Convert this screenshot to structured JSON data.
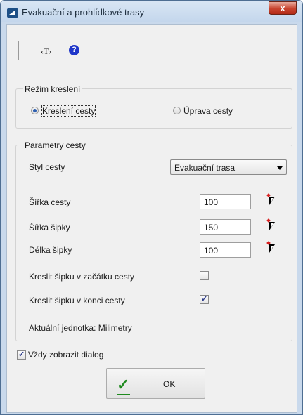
{
  "window": {
    "title": "Evakuační a prohlídkové trasy",
    "close_glyph": "x",
    "icons": [
      "app-icon",
      "close-icon"
    ]
  },
  "toolbar": {
    "text_tool_label": "‹T›",
    "help_glyph": "?",
    "icons": [
      "separator-handle-icon",
      "text-tool-icon",
      "help-icon"
    ]
  },
  "mode_group": {
    "title": "Režim kreslení",
    "options": [
      {
        "label": "Kreslení cesty",
        "selected": true
      },
      {
        "label": "Úprava cesty",
        "selected": false
      }
    ]
  },
  "params_group": {
    "title": "Parametry cesty",
    "style_label": "Styl cesty",
    "style_value": "Evakuační trasa",
    "path_width_label": "Šířka cesty",
    "path_width_value": "100",
    "arrow_width_label": "Šířka šipky",
    "arrow_width_value": "150",
    "arrow_length_label": "Délka šipky",
    "arrow_length_value": "100",
    "arrow_start_label": "Kreslit šipku v začátku cesty",
    "arrow_start_checked": false,
    "arrow_end_label": "Kreslit šipku v konci cesty",
    "arrow_end_checked": true,
    "units_text": "Aktuální jednotka: Milimetry",
    "pick_icon": "pick-from-drawing-icon"
  },
  "always_show": {
    "label": "Vždy zobrazit dialog",
    "checked": true
  },
  "ok_button": {
    "label": "OK",
    "icon": "green-check-icon"
  },
  "colors": {
    "title_bar": "#c9d9ec",
    "client": "#f0f0f0",
    "close": "#c8442f",
    "help": "#1f36c9",
    "ok_check": "#1e8a1e"
  }
}
